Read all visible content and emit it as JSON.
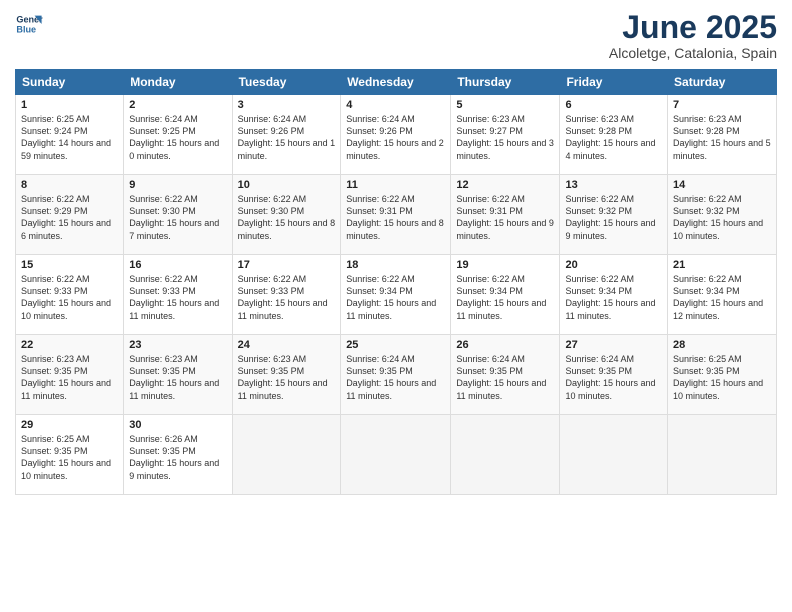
{
  "logo": {
    "line1": "General",
    "line2": "Blue"
  },
  "title": "June 2025",
  "subtitle": "Alcoletge, Catalonia, Spain",
  "days_header": [
    "Sunday",
    "Monday",
    "Tuesday",
    "Wednesday",
    "Thursday",
    "Friday",
    "Saturday"
  ],
  "weeks": [
    [
      {
        "day": "1",
        "sunrise": "6:25 AM",
        "sunset": "9:24 PM",
        "daylight": "14 hours and 59 minutes."
      },
      {
        "day": "2",
        "sunrise": "6:24 AM",
        "sunset": "9:25 PM",
        "daylight": "15 hours and 0 minutes."
      },
      {
        "day": "3",
        "sunrise": "6:24 AM",
        "sunset": "9:26 PM",
        "daylight": "15 hours and 1 minute."
      },
      {
        "day": "4",
        "sunrise": "6:24 AM",
        "sunset": "9:26 PM",
        "daylight": "15 hours and 2 minutes."
      },
      {
        "day": "5",
        "sunrise": "6:23 AM",
        "sunset": "9:27 PM",
        "daylight": "15 hours and 3 minutes."
      },
      {
        "day": "6",
        "sunrise": "6:23 AM",
        "sunset": "9:28 PM",
        "daylight": "15 hours and 4 minutes."
      },
      {
        "day": "7",
        "sunrise": "6:23 AM",
        "sunset": "9:28 PM",
        "daylight": "15 hours and 5 minutes."
      }
    ],
    [
      {
        "day": "8",
        "sunrise": "6:22 AM",
        "sunset": "9:29 PM",
        "daylight": "15 hours and 6 minutes."
      },
      {
        "day": "9",
        "sunrise": "6:22 AM",
        "sunset": "9:30 PM",
        "daylight": "15 hours and 7 minutes."
      },
      {
        "day": "10",
        "sunrise": "6:22 AM",
        "sunset": "9:30 PM",
        "daylight": "15 hours and 8 minutes."
      },
      {
        "day": "11",
        "sunrise": "6:22 AM",
        "sunset": "9:31 PM",
        "daylight": "15 hours and 8 minutes."
      },
      {
        "day": "12",
        "sunrise": "6:22 AM",
        "sunset": "9:31 PM",
        "daylight": "15 hours and 9 minutes."
      },
      {
        "day": "13",
        "sunrise": "6:22 AM",
        "sunset": "9:32 PM",
        "daylight": "15 hours and 9 minutes."
      },
      {
        "day": "14",
        "sunrise": "6:22 AM",
        "sunset": "9:32 PM",
        "daylight": "15 hours and 10 minutes."
      }
    ],
    [
      {
        "day": "15",
        "sunrise": "6:22 AM",
        "sunset": "9:33 PM",
        "daylight": "15 hours and 10 minutes."
      },
      {
        "day": "16",
        "sunrise": "6:22 AM",
        "sunset": "9:33 PM",
        "daylight": "15 hours and 11 minutes."
      },
      {
        "day": "17",
        "sunrise": "6:22 AM",
        "sunset": "9:33 PM",
        "daylight": "15 hours and 11 minutes."
      },
      {
        "day": "18",
        "sunrise": "6:22 AM",
        "sunset": "9:34 PM",
        "daylight": "15 hours and 11 minutes."
      },
      {
        "day": "19",
        "sunrise": "6:22 AM",
        "sunset": "9:34 PM",
        "daylight": "15 hours and 11 minutes."
      },
      {
        "day": "20",
        "sunrise": "6:22 AM",
        "sunset": "9:34 PM",
        "daylight": "15 hours and 11 minutes."
      },
      {
        "day": "21",
        "sunrise": "6:22 AM",
        "sunset": "9:34 PM",
        "daylight": "15 hours and 12 minutes."
      }
    ],
    [
      {
        "day": "22",
        "sunrise": "6:23 AM",
        "sunset": "9:35 PM",
        "daylight": "15 hours and 11 minutes."
      },
      {
        "day": "23",
        "sunrise": "6:23 AM",
        "sunset": "9:35 PM",
        "daylight": "15 hours and 11 minutes."
      },
      {
        "day": "24",
        "sunrise": "6:23 AM",
        "sunset": "9:35 PM",
        "daylight": "15 hours and 11 minutes."
      },
      {
        "day": "25",
        "sunrise": "6:24 AM",
        "sunset": "9:35 PM",
        "daylight": "15 hours and 11 minutes."
      },
      {
        "day": "26",
        "sunrise": "6:24 AM",
        "sunset": "9:35 PM",
        "daylight": "15 hours and 11 minutes."
      },
      {
        "day": "27",
        "sunrise": "6:24 AM",
        "sunset": "9:35 PM",
        "daylight": "15 hours and 10 minutes."
      },
      {
        "day": "28",
        "sunrise": "6:25 AM",
        "sunset": "9:35 PM",
        "daylight": "15 hours and 10 minutes."
      }
    ],
    [
      {
        "day": "29",
        "sunrise": "6:25 AM",
        "sunset": "9:35 PM",
        "daylight": "15 hours and 10 minutes."
      },
      {
        "day": "30",
        "sunrise": "6:26 AM",
        "sunset": "9:35 PM",
        "daylight": "15 hours and 9 minutes."
      },
      null,
      null,
      null,
      null,
      null
    ]
  ]
}
